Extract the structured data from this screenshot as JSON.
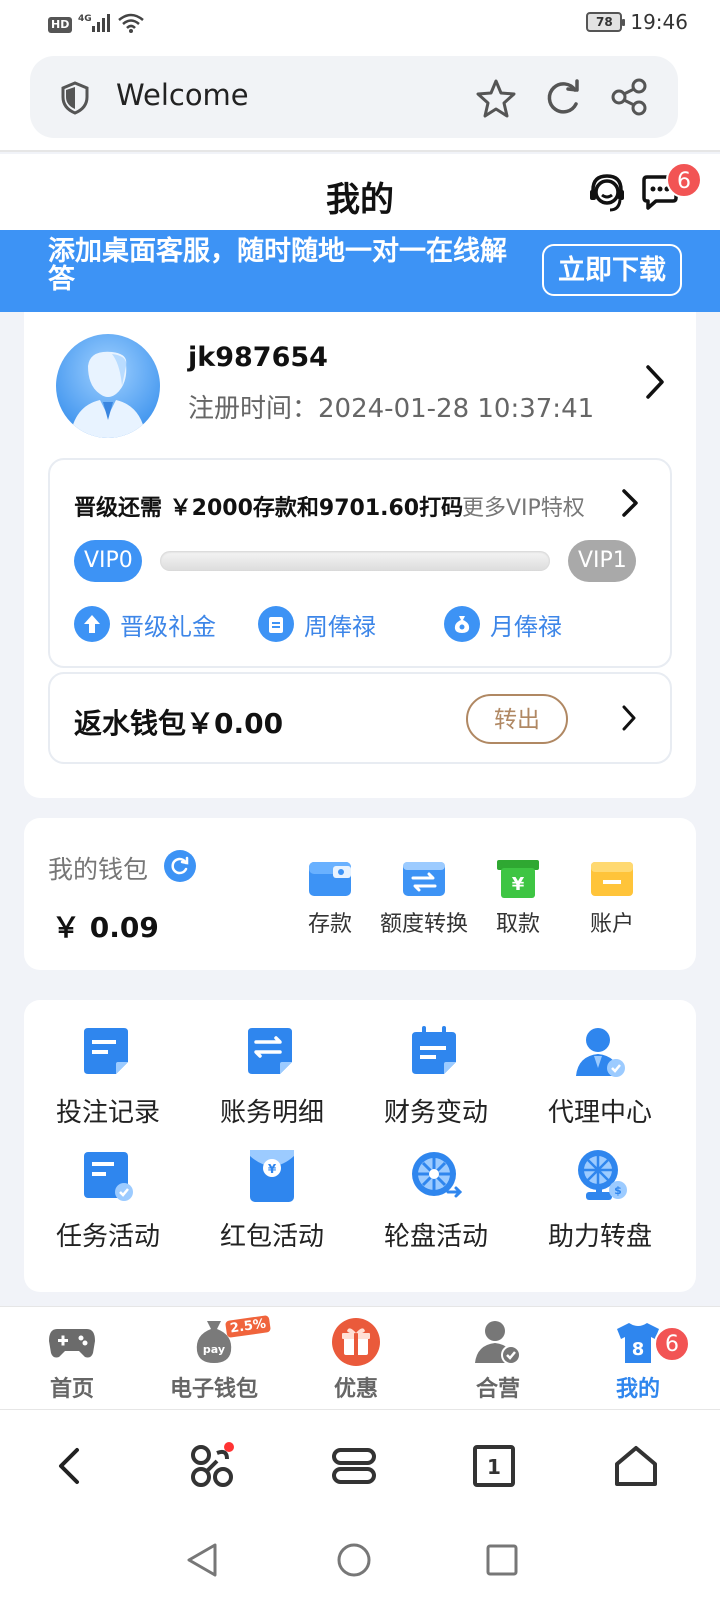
{
  "status_bar": {
    "hd": "HD",
    "network": "4G",
    "battery": "78",
    "time": "19:46"
  },
  "browser": {
    "title": "Welcome",
    "icons": [
      "shield-icon",
      "star-icon",
      "refresh-icon",
      "share-icon"
    ]
  },
  "header": {
    "title": "我的",
    "message_badge": "6"
  },
  "banner": {
    "text": "添加桌面客服，随时随地一对一在线解答",
    "button": "立即下载"
  },
  "profile": {
    "username": "jk987654",
    "reg_label": "注册时间：",
    "reg_time": "2024-01-28 10:37:41"
  },
  "vip": {
    "need_text": "晋级还需 ￥2000存款和9701.60打码",
    "more": "更多VIP特权",
    "current": "VIP0",
    "next": "VIP1",
    "progress": 0,
    "perks": [
      "晋级礼金",
      "周俸禄",
      "月俸禄"
    ]
  },
  "rebate": {
    "label": "返水钱包￥0.00",
    "button": "转出"
  },
  "wallet": {
    "title": "我的钱包",
    "amount": "￥ 0.09",
    "actions": [
      "存款",
      "额度转换",
      "取款",
      "账户"
    ]
  },
  "grid": {
    "items": [
      "投注记录",
      "账务明细",
      "财务变动",
      "代理中心",
      "任务活动",
      "红包活动",
      "轮盘活动",
      "助力转盘"
    ]
  },
  "tabs": {
    "items": [
      "首页",
      "电子钱包",
      "优惠",
      "合营",
      "我的"
    ],
    "active": "我的",
    "badge": "6",
    "wallet_tag": "2.5%",
    "pay_label": "pay"
  },
  "browser_bottom": {
    "tab_count": "1"
  },
  "colors": {
    "accent": "#3d93f5",
    "badge": "#f25454",
    "rebate_btn": "#b08863"
  }
}
